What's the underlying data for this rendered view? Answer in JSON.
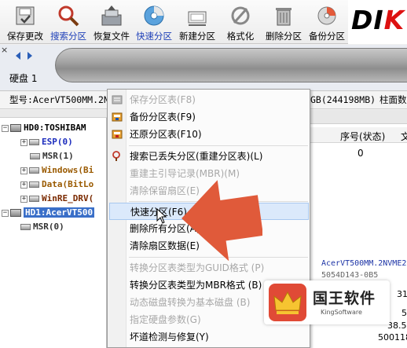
{
  "toolbar": {
    "buttons": [
      {
        "label": "保存更改",
        "icon": "save-disk-icon"
      },
      {
        "label": "搜索分区",
        "icon": "magnifier-icon"
      },
      {
        "label": "恢复文件",
        "icon": "file-recovery-icon"
      },
      {
        "label": "快速分区",
        "icon": "quick-partition-disc-icon"
      },
      {
        "label": "新建分区",
        "icon": "new-partition-icon"
      },
      {
        "label": "格式化",
        "icon": "format-icon"
      },
      {
        "label": "删除分区",
        "icon": "trash-icon"
      },
      {
        "label": "备份分区",
        "icon": "backup-icon"
      }
    ],
    "logo_text_1": "DI",
    "logo_text_2": "K"
  },
  "diskbar": {
    "close": "×",
    "disk_label": "硬盘 1"
  },
  "infoline": {
    "model": "型号:AcerVT500MM.2NV",
    "capacity": "GB(244198MB)",
    "cylinders": "柱面数"
  },
  "tree": {
    "nodes": [
      {
        "text": "HD0:TOSHIBAM",
        "kind": "disk"
      },
      {
        "text": "ESP(0)",
        "kind": "part",
        "color": "#1b2bbd"
      },
      {
        "text": "MSR(1)",
        "kind": "part",
        "color": "#333333"
      },
      {
        "text": "Windows(Bi",
        "kind": "part",
        "color": "#9a5a00"
      },
      {
        "text": "Data(BitLo",
        "kind": "part",
        "color": "#9a5a00"
      },
      {
        "text": "WinRE_DRV(",
        "kind": "part",
        "color": "#7a2a00"
      },
      {
        "text": "HD1:AcerVT500",
        "kind": "disk",
        "selected": true
      },
      {
        "text": "MSR(0)",
        "kind": "part",
        "color": "#333333"
      }
    ]
  },
  "right_panel": {
    "col_status": "序号(状态)",
    "col_partial": "文",
    "row0_index": "0",
    "detail1": "AcerVT500MM.2NVME29",
    "detail2": "5054D143-0B5",
    "num1": "31",
    "num2": "5",
    "num3": "38.5",
    "num4": "500118"
  },
  "context_menu": {
    "items": [
      {
        "label": "保存分区表(F8)",
        "disabled": true,
        "icon": "save-table-icon"
      },
      {
        "label": "备份分区表(F9)",
        "disabled": false,
        "icon": "backup-table-icon"
      },
      {
        "label": "还原分区表(F10)",
        "disabled": false,
        "icon": "restore-table-icon"
      },
      {
        "label": "搜索已丢失分区(重建分区表)(L)",
        "disabled": false,
        "icon": "search-lost-icon"
      },
      {
        "label": "重建主引导记录(MBR)(M)",
        "disabled": true
      },
      {
        "label": "清除保留扇区(E)",
        "disabled": true
      },
      {
        "label": "快速分区(F6)",
        "disabled": false,
        "highlighted": true
      },
      {
        "label": "删除所有分区(A)",
        "disabled": false
      },
      {
        "label": "清除扇区数据(E)",
        "disabled": false
      },
      {
        "label": "转换分区表类型为GUID格式 (P)",
        "disabled": true
      },
      {
        "label": "转换分区表类型为MBR格式 (B)",
        "disabled": false
      },
      {
        "label": "动态磁盘转换为基本磁盘 (B)",
        "disabled": true
      },
      {
        "label": "指定硬盘参数(G)",
        "disabled": true
      },
      {
        "label": "坏道检测与修复(Y)",
        "disabled": false
      }
    ]
  },
  "watermark": {
    "name": "国王软件",
    "sub": "KingSoftware"
  },
  "colors": {
    "highlight": "#3a6fc8",
    "arrow": "#e05a3a",
    "menu_hover": "#dbe9fb"
  }
}
